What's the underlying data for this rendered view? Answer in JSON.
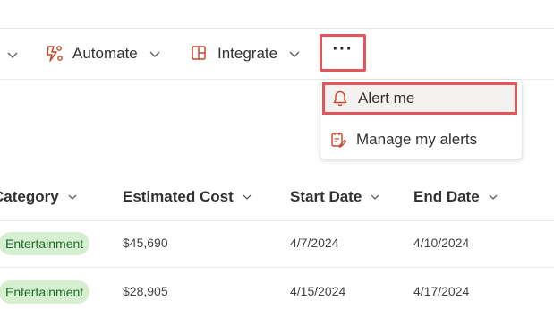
{
  "toolbar": {
    "automate_label": "Automate",
    "integrate_label": "Integrate",
    "more_label": "···"
  },
  "menu": {
    "items": [
      {
        "label": "Alert me",
        "icon": "bell-icon"
      },
      {
        "label": "Manage my alerts",
        "icon": "manage-alerts-icon"
      }
    ]
  },
  "table": {
    "columns": [
      "Category",
      "Estimated Cost",
      "Start Date",
      "End Date"
    ],
    "rows": [
      {
        "category": "Entertainment",
        "cost": "$45,690",
        "start": "4/7/2024",
        "end": "4/10/2024"
      },
      {
        "category": "Entertainment",
        "cost": "$28,905",
        "start": "4/15/2024",
        "end": "4/17/2024"
      }
    ]
  },
  "colors": {
    "accent": "#c4472a",
    "highlight_border": "#e4555a",
    "pill_bg": "#d5efd0",
    "pill_text": "#1f6b2a"
  }
}
